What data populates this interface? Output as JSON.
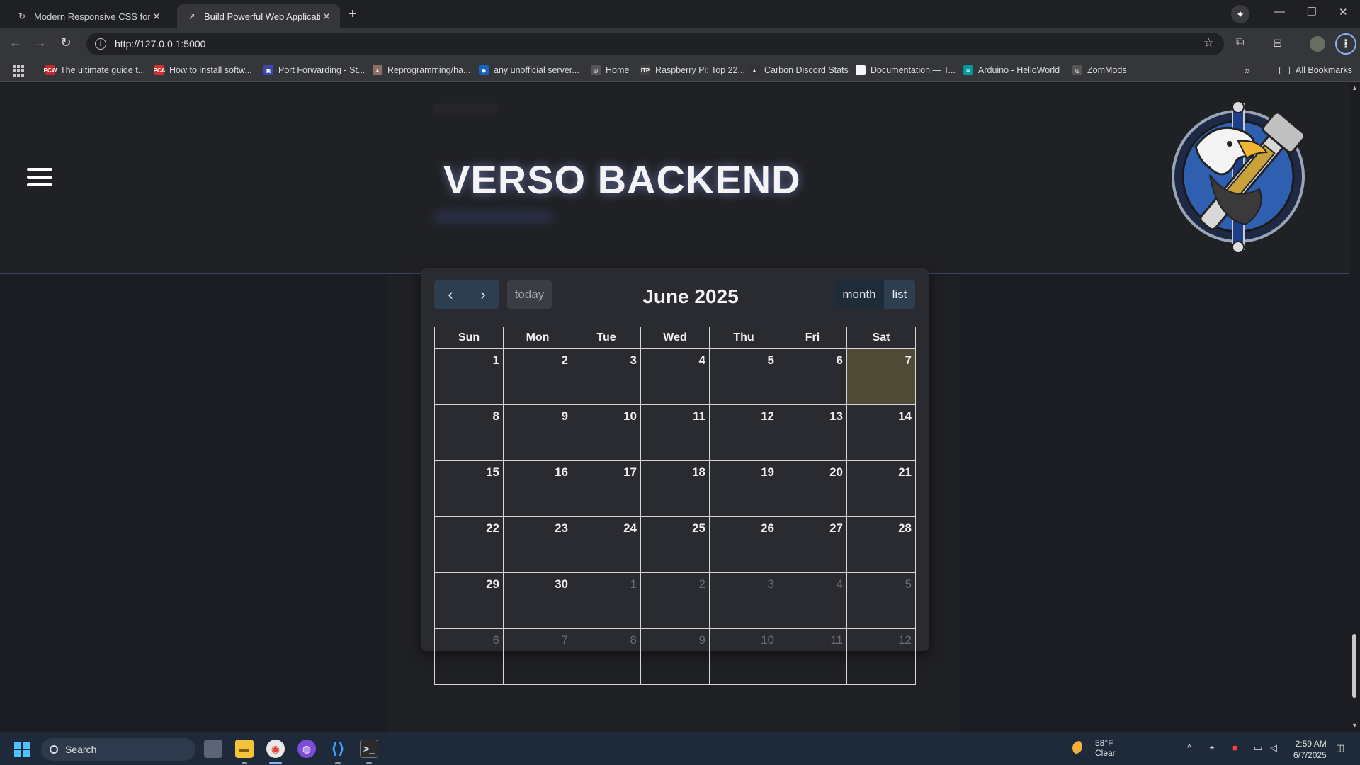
{
  "browser": {
    "tabs": [
      {
        "title": "Modern Responsive CSS for We",
        "active": false
      },
      {
        "title": "Build Powerful Web Application",
        "active": true
      }
    ],
    "url": "http://127.0.0.1:5000",
    "bookmarks": [
      {
        "label": "The ultimate guide t...",
        "icon": "pcw-icon",
        "color": "#c62828",
        "badge": "PCW"
      },
      {
        "label": "How to install softw...",
        "icon": "pca-icon",
        "color": "#d32f2f",
        "badge": "PCA"
      },
      {
        "label": "Port Forwarding - St...",
        "icon": "port-icon",
        "color": "#3949ab",
        "badge": "▣"
      },
      {
        "label": "Reprogramming/ha...",
        "icon": "person-icon",
        "color": "#8d6e63",
        "badge": "▲"
      },
      {
        "label": "any unofficial server...",
        "icon": "steam-icon",
        "color": "#1565c0",
        "badge": "◆"
      },
      {
        "label": "Home",
        "icon": "globe-icon",
        "color": "#555555",
        "badge": "◎"
      },
      {
        "label": "Raspberry Pi: Top 22...",
        "icon": "itp-icon",
        "color": "#424242",
        "badge": "ITP"
      },
      {
        "label": "Carbon Discord Stats",
        "icon": "carbon-icon",
        "color": "#333333",
        "badge": "▲"
      },
      {
        "label": "Documentation — T...",
        "icon": "doc-icon",
        "color": "#f5f5f5",
        "badge": ""
      },
      {
        "label": "Arduino - HelloWorld",
        "icon": "arduino-icon",
        "color": "#00979c",
        "badge": "∞"
      },
      {
        "label": "ZomMods",
        "icon": "globe-icon",
        "color": "#555555",
        "badge": "◎"
      }
    ],
    "all_bookmarks": "All Bookmarks"
  },
  "site": {
    "title": "VERSO BACKEND"
  },
  "calendar": {
    "title": "June 2025",
    "today_label": "today",
    "month_label": "month",
    "list_label": "list",
    "weekdays": [
      "Sun",
      "Mon",
      "Tue",
      "Wed",
      "Thu",
      "Fri",
      "Sat"
    ],
    "weeks": [
      [
        {
          "d": "1"
        },
        {
          "d": "2"
        },
        {
          "d": "3"
        },
        {
          "d": "4"
        },
        {
          "d": "5"
        },
        {
          "d": "6"
        },
        {
          "d": "7",
          "today": true
        }
      ],
      [
        {
          "d": "8"
        },
        {
          "d": "9"
        },
        {
          "d": "10"
        },
        {
          "d": "11"
        },
        {
          "d": "12"
        },
        {
          "d": "13"
        },
        {
          "d": "14"
        }
      ],
      [
        {
          "d": "15"
        },
        {
          "d": "16"
        },
        {
          "d": "17"
        },
        {
          "d": "18"
        },
        {
          "d": "19"
        },
        {
          "d": "20"
        },
        {
          "d": "21"
        }
      ],
      [
        {
          "d": "22"
        },
        {
          "d": "23"
        },
        {
          "d": "24"
        },
        {
          "d": "25"
        },
        {
          "d": "26"
        },
        {
          "d": "27"
        },
        {
          "d": "28"
        }
      ],
      [
        {
          "d": "29"
        },
        {
          "d": "30"
        },
        {
          "d": "1",
          "other": true
        },
        {
          "d": "2",
          "other": true
        },
        {
          "d": "3",
          "other": true
        },
        {
          "d": "4",
          "other": true
        },
        {
          "d": "5",
          "other": true
        }
      ],
      [
        {
          "d": "6",
          "other": true
        },
        {
          "d": "7",
          "other": true
        },
        {
          "d": "8",
          "other": true
        },
        {
          "d": "9",
          "other": true
        },
        {
          "d": "10",
          "other": true
        },
        {
          "d": "11",
          "other": true
        },
        {
          "d": "12",
          "other": true
        }
      ]
    ]
  },
  "taskbar": {
    "search_placeholder": "Search",
    "weather_temp": "58°F",
    "weather_desc": "Clear",
    "time": "2:59 AM",
    "date": "6/7/2025"
  },
  "colors": {
    "today_highlight": "#4e4a35",
    "button_primary": "#2c3e50",
    "button_active": "#1e2b39",
    "accent_border": "#3a4663"
  }
}
